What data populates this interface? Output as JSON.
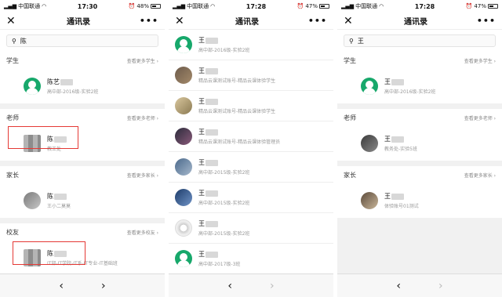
{
  "phone1": {
    "status": {
      "carrier": "中国联通",
      "time": "17:30",
      "battery": "48%",
      "level": 0.48
    },
    "nav": {
      "close": "✕",
      "title": "通讯录",
      "more": "•••"
    },
    "search": {
      "value": "陈"
    },
    "sections": {
      "students": {
        "name": "学生",
        "more": "查看更多学生 ›"
      },
      "teachers": {
        "name": "老师",
        "more": "查看更多老师 ›"
      },
      "parents": {
        "name": "家长",
        "more": "查看更多家长 ›"
      },
      "alumni": {
        "name": "校友",
        "more": "查看更多校友 ›"
      }
    },
    "rows": [
      {
        "name": "陈艺",
        "sub": "高中部-2016级-实验2班"
      },
      {
        "name": "陈",
        "sub": "教工处"
      },
      {
        "name": "陈",
        "sub": "王小二莫莫"
      },
      {
        "name": "陈",
        "sub": "IT部-IT学院-IT系-IT专业-IT基础班"
      }
    ],
    "footer": {
      "back": "‹",
      "fwd": "›"
    }
  },
  "phone2": {
    "status": {
      "carrier": "中国联通",
      "time": "17:28",
      "battery": "47%",
      "level": 0.47
    },
    "nav": {
      "close": "✕",
      "title": "通讯录",
      "more": "•••"
    },
    "rows": [
      {
        "name": "王",
        "sub": "高中部-2016级-实验2班"
      },
      {
        "name": "王",
        "sub": "精品云课测试账号-精品云课体验学生"
      },
      {
        "name": "王",
        "sub": "精品云课测试账号-精品云课体验学生"
      },
      {
        "name": "王",
        "sub": "精品云课测试账号-精品云课体验管理员"
      },
      {
        "name": "王",
        "sub": "高中部-2015级-实验2班"
      },
      {
        "name": "王",
        "sub": "高中部-2015级-实验2班"
      },
      {
        "name": "王",
        "sub": "高中部-2015级-实验2班"
      },
      {
        "name": "王",
        "sub": "高中部-2017级-3班"
      }
    ],
    "footer": {
      "back": "‹",
      "fwd": "›"
    }
  },
  "phone3": {
    "status": {
      "carrier": "中国联通",
      "time": "17:28",
      "battery": "47%",
      "level": 0.47
    },
    "nav": {
      "close": "✕",
      "title": "通讯录",
      "more": "•••"
    },
    "search": {
      "value": "王"
    },
    "sections": {
      "students": {
        "name": "学生",
        "more": "查看更多学生 ›"
      },
      "teachers": {
        "name": "老师",
        "more": "查看更多老师 ›"
      },
      "parents": {
        "name": "家长",
        "more": "查看更多家长 ›"
      }
    },
    "rows": [
      {
        "name": "王",
        "sub": "高中部-2016级-实验2班"
      },
      {
        "name": "王",
        "sub": "教务处-实验5班"
      },
      {
        "name": "王",
        "sub": "体验账号01测试"
      }
    ],
    "footer": {
      "back": "‹",
      "fwd": "›"
    }
  }
}
